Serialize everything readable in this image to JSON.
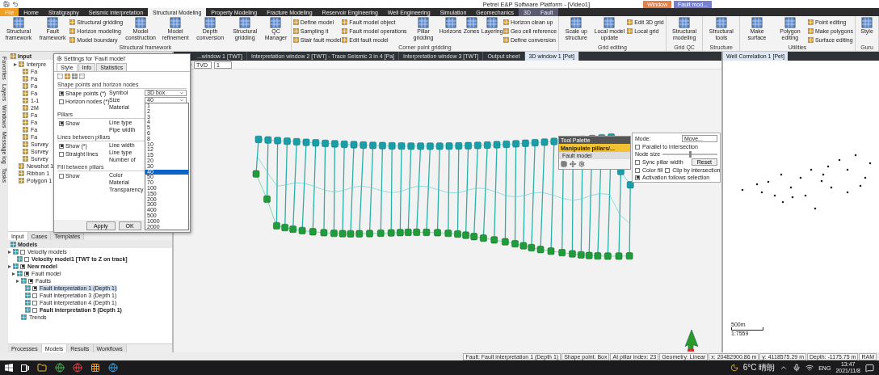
{
  "title_bar": {
    "title": "Petrel E&P Software Platform - [Video1]",
    "context_tabs": [
      {
        "label": "Window",
        "color": "#e0804a"
      },
      {
        "label": "Fault mod...",
        "color": "#7880d0"
      }
    ]
  },
  "ribbon": {
    "tabs": [
      {
        "label": "File",
        "kind": "file",
        "selected": false
      },
      {
        "label": "Home",
        "kind": "tab",
        "selected": false
      },
      {
        "label": "Stratigraphy",
        "kind": "tab",
        "selected": false
      },
      {
        "label": "Seismic interpretation",
        "kind": "tab",
        "selected": false
      },
      {
        "label": "Structural Modeling",
        "kind": "tab",
        "selected": true
      },
      {
        "label": "Property Modeling",
        "kind": "tab",
        "selected": false
      },
      {
        "label": "Fracture Modeling",
        "kind": "tab",
        "selected": false
      },
      {
        "label": "Reservoir Engineering",
        "kind": "tab",
        "selected": false
      },
      {
        "label": "Well Engineering",
        "kind": "tab",
        "selected": false
      },
      {
        "label": "Simulation",
        "kind": "tab",
        "selected": false
      },
      {
        "label": "Geomechanics",
        "kind": "tab",
        "selected": false
      },
      {
        "label": "3D",
        "kind": "context",
        "selected": false
      },
      {
        "label": "Fault",
        "kind": "context",
        "selected": false
      }
    ],
    "groups": [
      {
        "label": "Structural framework",
        "items": [
          {
            "label": "Structural framework",
            "kind": "large"
          },
          {
            "label": "Fault framework",
            "kind": "large"
          },
          {
            "label": "Structural gridding",
            "kind": "small"
          },
          {
            "label": "Horizon modeling",
            "kind": "small"
          },
          {
            "label": "Model boundary",
            "kind": "small"
          },
          {
            "label": "Model construction",
            "kind": "large"
          },
          {
            "label": "Model refinement",
            "kind": "large"
          },
          {
            "label": "Depth conversion",
            "kind": "large"
          },
          {
            "label": "Structural gridding",
            "kind": "large"
          },
          {
            "label": "QC Manager",
            "kind": "large"
          }
        ]
      },
      {
        "label": "Corner point gridding",
        "items": [
          {
            "label": "Define model",
            "kind": "small"
          },
          {
            "label": "Sampling it",
            "kind": "small"
          },
          {
            "label": "Stair fault model",
            "kind": "small"
          },
          {
            "label": "Fault model object",
            "kind": "small"
          },
          {
            "label": "Fault model operations",
            "kind": "small"
          },
          {
            "label": "Edit fault model",
            "kind": "small"
          },
          {
            "label": "Pillar gridding",
            "kind": "large"
          },
          {
            "label": "Horizons",
            "kind": "large"
          },
          {
            "label": "Zones",
            "kind": "large"
          },
          {
            "label": "Layering",
            "kind": "large"
          },
          {
            "label": "Horizon clean up",
            "kind": "small"
          },
          {
            "label": "Geo cell reference",
            "kind": "small"
          },
          {
            "label": "Define conversion",
            "kind": "small"
          }
        ]
      },
      {
        "label": "Grid editing",
        "items": [
          {
            "label": "Scale up structure",
            "kind": "large"
          },
          {
            "label": "Local model update",
            "kind": "large"
          },
          {
            "label": "Edit 3D grid",
            "kind": "small"
          },
          {
            "label": "Local grid",
            "kind": "small"
          }
        ]
      },
      {
        "label": "Grid QC",
        "items": [
          {
            "label": "Structural modeling",
            "kind": "large"
          }
        ]
      },
      {
        "label": "Structure",
        "items": [
          {
            "label": "Structural tools",
            "kind": "large"
          }
        ]
      },
      {
        "label": "Utilities",
        "items": [
          {
            "label": "Make surface",
            "kind": "large"
          },
          {
            "label": "Polygon editing",
            "kind": "large"
          },
          {
            "label": "Point editing",
            "kind": "small"
          },
          {
            "label": "Make polygons",
            "kind": "small"
          },
          {
            "label": "Surface editing",
            "kind": "small"
          }
        ]
      },
      {
        "label": "Guru",
        "items": [
          {
            "label": "Style",
            "kind": "large"
          }
        ]
      }
    ]
  },
  "side_tabs": [
    "Favorites",
    "Layers",
    "Windows",
    "Message log",
    "Tasks"
  ],
  "input_pane": {
    "title": "Input",
    "tree": [
      {
        "label": "Interpre",
        "selected": false,
        "children": [
          {
            "label": "Fa",
            "selected": false
          },
          {
            "label": "Fa",
            "selected": false
          },
          {
            "label": "Fa",
            "selected": false
          },
          {
            "label": "Fa",
            "selected": false
          },
          {
            "label": "1-1",
            "selected": false
          },
          {
            "label": "2M",
            "selected": false
          },
          {
            "label": "Fa",
            "selected": false
          },
          {
            "label": "Fa",
            "selected": false
          },
          {
            "label": "Fa",
            "selected": false
          },
          {
            "label": "Fa",
            "selected": false
          },
          {
            "label": "Survey",
            "selected": false
          },
          {
            "label": "Survey",
            "selected": false
          },
          {
            "label": "Survey",
            "selected": false
          }
        ]
      },
      {
        "label": "Newshot 1",
        "selected": false
      },
      {
        "label": "Ribbon 1",
        "selected": false
      },
      {
        "label": "Polygon 1",
        "selected": false
      }
    ],
    "tabs": [
      {
        "label": "Input",
        "selected": true
      },
      {
        "label": "Cases",
        "selected": false
      },
      {
        "label": "Templates",
        "selected": false
      }
    ]
  },
  "models_pane": {
    "title": "Models",
    "tree": [
      {
        "label": "Velocity models",
        "bold": false,
        "selected": false,
        "checked": false,
        "children": [
          {
            "label": "Velocity model1 [TWT to Z on track]",
            "bold": true,
            "selected": false,
            "checked": false
          }
        ]
      },
      {
        "label": "New model",
        "bold": true,
        "selected": false,
        "checked": true,
        "children": [
          {
            "label": "Fault model",
            "bold": false,
            "selected": false,
            "checked": true,
            "children": [
              {
                "label": "Faults",
                "bold": false,
                "selected": false,
                "checked": true,
                "children": [
                  {
                    "label": "Fault interpretation 1 (Depth 1)",
                    "bold": false,
                    "selected": true,
                    "checked": true
                  },
                  {
                    "label": "Fault interpretation 3 (Depth 1)",
                    "bold": false,
                    "selected": false,
                    "checked": false
                  },
                  {
                    "label": "Fault interpretation 4 (Depth 1)",
                    "bold": false,
                    "selected": false,
                    "checked": false
                  },
                  {
                    "label": "Fault interpretation 5 (Depth 1)",
                    "bold": true,
                    "selected": false,
                    "checked": false
                  }
                ]
              },
              {
                "label": "Trends",
                "bold": false,
                "selected": false
              }
            ]
          }
        ]
      }
    ],
    "tabs": [
      {
        "label": "Processes",
        "selected": false
      },
      {
        "label": "Models",
        "selected": true
      },
      {
        "label": "Results",
        "selected": false
      },
      {
        "label": "Workflows",
        "selected": false
      }
    ]
  },
  "window_tabs": [
    {
      "label": "...window 1 [TWT]",
      "selected": false
    },
    {
      "label": "Interpretation window 2 [TWT] - Trace Seismic 3 in 4 [Pa]",
      "selected": false
    },
    {
      "label": "Interpretation window 3 [TWT]",
      "selected": false
    },
    {
      "label": "Output sheet",
      "selected": false
    },
    {
      "label": "3D window 1 [Pet]",
      "selected": true
    }
  ],
  "view_toolbar": {
    "domain": "TVD",
    "value": "1"
  },
  "dialog": {
    "title": "Settings for 'Fault model'",
    "tabs": [
      {
        "label": "Style",
        "selected": true
      },
      {
        "label": "Info",
        "selected": false
      },
      {
        "label": "Statistics",
        "selected": false
      }
    ],
    "sections": [
      {
        "heading": "Shape points and horizon nodes",
        "checks": [
          {
            "label": "Shape points (*)",
            "checked": true
          },
          {
            "label": "Horizon nodes (*)",
            "checked": false
          }
        ],
        "fields": [
          {
            "label": "Symbol",
            "kind": "select",
            "value": "3D box"
          },
          {
            "label": "Size",
            "kind": "select",
            "value": "40"
          },
          {
            "label": "Material",
            "kind": "label"
          }
        ]
      },
      {
        "heading": "Pillars",
        "checks": [
          {
            "label": "Show",
            "checked": true
          }
        ],
        "fields": [
          {
            "label": "Line type",
            "kind": "label"
          },
          {
            "label": "Pipe width",
            "kind": "label"
          }
        ]
      },
      {
        "heading": "Lines between pillars",
        "checks": [
          {
            "label": "Show (*)",
            "checked": true
          },
          {
            "label": "Straight lines",
            "checked": false
          }
        ],
        "fields": [
          {
            "label": "Line width",
            "kind": "label"
          },
          {
            "label": "Line type",
            "kind": "label"
          },
          {
            "label": "Number of",
            "kind": "label"
          }
        ]
      },
      {
        "heading": "Fill between pillars",
        "checks": [
          {
            "label": "Show",
            "checked": false
          }
        ],
        "fields": [
          {
            "label": "Color",
            "kind": "label"
          },
          {
            "label": "Material",
            "kind": "label"
          },
          {
            "label": "Transparency",
            "kind": "label"
          }
        ]
      }
    ],
    "buttons": [
      "Apply",
      "OK"
    ],
    "size_options": [
      {
        "label": "1",
        "selected": false
      },
      {
        "label": "2",
        "selected": false
      },
      {
        "label": "3",
        "selected": false
      },
      {
        "label": "4",
        "selected": false
      },
      {
        "label": "5",
        "selected": false
      },
      {
        "label": "6",
        "selected": false
      },
      {
        "label": "8",
        "selected": false
      },
      {
        "label": "10",
        "selected": false
      },
      {
        "label": "12",
        "selected": false
      },
      {
        "label": "15",
        "selected": false
      },
      {
        "label": "20",
        "selected": false
      },
      {
        "label": "30",
        "selected": false
      },
      {
        "label": "40",
        "selected": true
      },
      {
        "label": "50",
        "selected": false
      },
      {
        "label": "70",
        "selected": false
      },
      {
        "label": "100",
        "selected": false
      },
      {
        "label": "150",
        "selected": false
      },
      {
        "label": "200",
        "selected": false
      },
      {
        "label": "300",
        "selected": false
      },
      {
        "label": "400",
        "selected": false
      },
      {
        "label": "500",
        "selected": false
      },
      {
        "label": "1000",
        "selected": false
      },
      {
        "label": "2000",
        "selected": false
      }
    ]
  },
  "tool_palette": {
    "title": "Tool Palette",
    "tool": "Manipulate pillars/...",
    "section": "Fault model"
  },
  "mode_panel": {
    "mode_label": "Mode:",
    "mode_value": "Move...",
    "node_size_label": "Node size",
    "node_size": {
      "level": 0.5
    },
    "reset": "Reset",
    "checks": [
      {
        "label": "Parallel to intersection",
        "checked": false
      },
      {
        "label": "Sync pillar width",
        "checked": false
      },
      {
        "label": "Color fill",
        "checked": false
      },
      {
        "label": "Clip by intersection",
        "checked": false
      },
      {
        "label": "Activation follows selection",
        "checked": true
      }
    ]
  },
  "map_window": {
    "tab": "Well Correlation 1 [Pet]",
    "scale": "500m",
    "ratio": "1:7559"
  },
  "status_bar": [
    "Fault: Fault interpretation 1 (Depth 1)",
    "Shape point: Box",
    "At pillar index: 23",
    "Geometry: Linear",
    "x: 20482900.86 m",
    "y: 4118575.29 m",
    "Depth: -1175.75 m",
    "RAM"
  ],
  "taskbar": {
    "weather": "6°C 晴朗",
    "language": "ENG",
    "time": "13:47",
    "date": "2021/11/8"
  }
}
